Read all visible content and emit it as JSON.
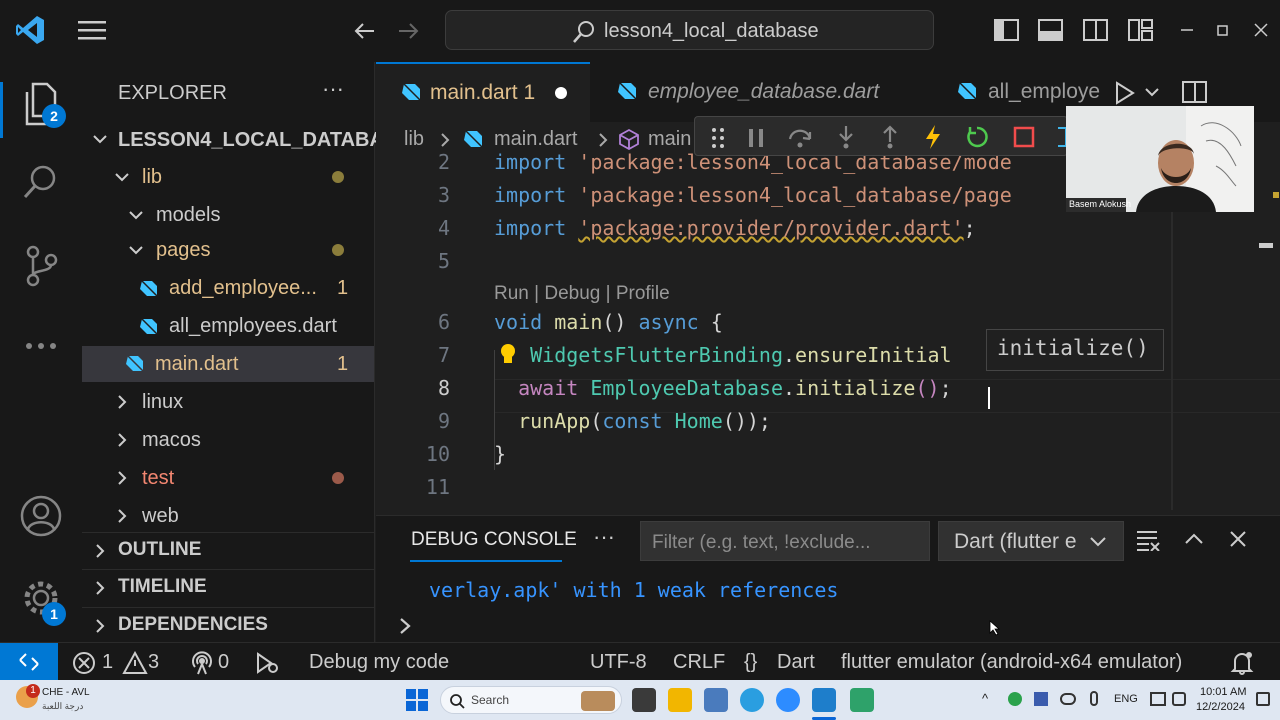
{
  "title_bar": {
    "search_text": "lesson4_local_database"
  },
  "activity_bar": {
    "explorer_badge": "2",
    "settings_badge": "1"
  },
  "sidebar": {
    "header": "EXPLORER",
    "more": "···",
    "project": "LESSON4_LOCAL_DATABASE",
    "tree": [
      {
        "label": "lib",
        "type": "folder-open"
      },
      {
        "label": "models",
        "type": "folder-open"
      },
      {
        "label": "pages",
        "type": "folder-open"
      },
      {
        "label": "add_employee... ",
        "type": "file",
        "badge": "1"
      },
      {
        "label": "all_employees.dart",
        "type": "file"
      },
      {
        "label": "main.dart",
        "type": "file",
        "badge": "1"
      },
      {
        "label": "linux",
        "type": "folder"
      },
      {
        "label": "macos",
        "type": "folder"
      },
      {
        "label": "test",
        "type": "folder"
      },
      {
        "label": "web",
        "type": "folder"
      }
    ],
    "sections": [
      "OUTLINE",
      "TIMELINE",
      "DEPENDENCIES"
    ]
  },
  "tabs": [
    {
      "label": "main.dart",
      "badge": "1"
    },
    {
      "label": "employee_database.dart"
    },
    {
      "label": "all_employe"
    }
  ],
  "breadcrumbs": {
    "folder": "lib",
    "file": "main.dart",
    "symbol": "main"
  },
  "editor": {
    "lines": [
      {
        "n": "2",
        "parts": [
          [
            "kw",
            "import "
          ],
          [
            "str",
            "'package:lesson4_local_database/mode"
          ]
        ]
      },
      {
        "n": "3",
        "parts": [
          [
            "kw",
            "import "
          ],
          [
            "str",
            "'package:lesson4_local_database/page"
          ]
        ]
      },
      {
        "n": "4",
        "parts": [
          [
            "kw",
            "import "
          ],
          [
            "str",
            "'package:provider/provider.dart'"
          ],
          [
            "pln",
            ";"
          ]
        ]
      },
      {
        "n": "5",
        "parts": []
      },
      {
        "n": "",
        "parts": [
          [
            "lens",
            "Run | Debug | Profile"
          ]
        ]
      },
      {
        "n": "6",
        "parts": [
          [
            "kw",
            "void "
          ],
          [
            "fn",
            "main"
          ],
          [
            "pln",
            "() "
          ],
          [
            "kw",
            "async "
          ],
          [
            "pln",
            "{"
          ]
        ]
      },
      {
        "n": "7",
        "parts": [
          [
            "pln",
            "   "
          ],
          [
            "cls",
            "WidgetsFlutterBinding"
          ],
          [
            "pln",
            "."
          ],
          [
            "fn",
            "ensureInitial"
          ]
        ]
      },
      {
        "n": "8",
        "parts": [
          [
            "pln",
            "  "
          ],
          [
            "ctl",
            "await "
          ],
          [
            "cls",
            "EmployeeDatabase"
          ],
          [
            "pln",
            "."
          ],
          [
            "fn",
            "initialize"
          ],
          [
            "ctl",
            "()"
          ],
          [
            "pln",
            ";"
          ]
        ]
      },
      {
        "n": "9",
        "parts": [
          [
            "pln",
            "  "
          ],
          [
            "fn",
            "runApp"
          ],
          [
            "pln",
            "("
          ],
          [
            "kw",
            "const "
          ],
          [
            "cls",
            "Home"
          ],
          [
            "pln",
            "());"
          ]
        ]
      },
      {
        "n": "10",
        "parts": [
          [
            "pln",
            "}"
          ]
        ]
      },
      {
        "n": "11",
        "parts": []
      }
    ],
    "hover_hint": "initialize()"
  },
  "video": {
    "name": "Basem Alokush"
  },
  "panel": {
    "title": "DEBUG CONSOLE",
    "more": "···",
    "filter_placeholder": "Filter (e.g. text, !exclude...",
    "dropdown": "Dart (flutter e",
    "output": "verlay.apk' with 1 weak references"
  },
  "status_bar": {
    "errors": "1",
    "warnings": "3",
    "ports": "0",
    "debug": "Debug my code",
    "encoding": "UTF-8",
    "eol": "CRLF",
    "language": "Dart",
    "device": "flutter emulator (android-x64 emulator)"
  },
  "taskbar": {
    "weather_badge": "1",
    "weather_title": "CHE - AVL",
    "weather_sub": "درجة اللعبة",
    "search": "Search",
    "lang": "ENG",
    "time": "10:01 AM",
    "date": "12/2/2024"
  },
  "colors": {
    "accent": "#0078d4",
    "keyword": "#569cd6",
    "string": "#ce9178",
    "function": "#dcdcaa",
    "class": "#4ec9b0"
  }
}
